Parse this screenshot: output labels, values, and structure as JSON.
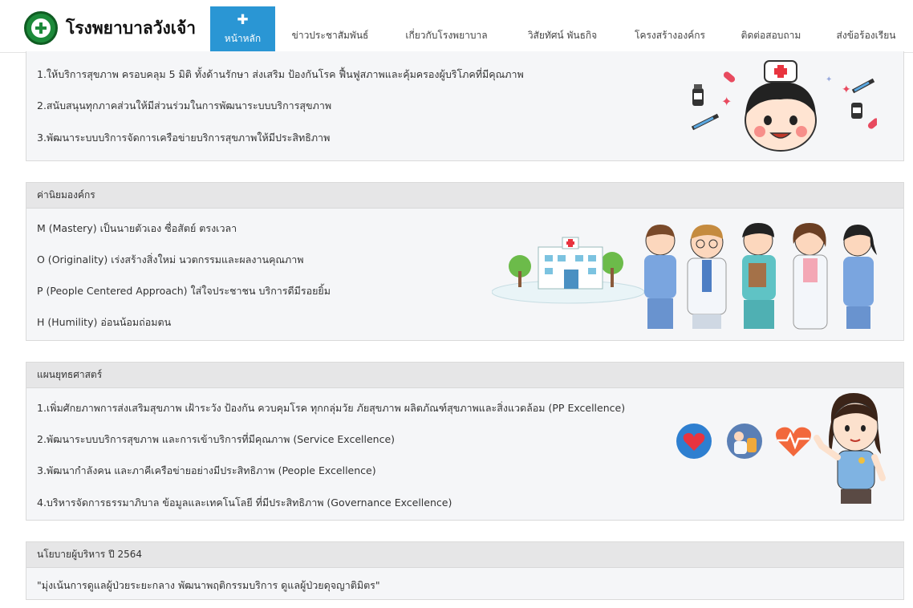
{
  "header": {
    "brand_name": "โรงพยาบาลวังเจ้า",
    "nav": {
      "home_label": "หน้าหลัก",
      "items": [
        "ข่าวประชาสัมพันธ์",
        "เกี่ยวกับโรงพยาบาล",
        "วิสัยทัศน์ พันธกิจ",
        "โครงสร้างองค์กร",
        "ติดต่อสอบถาม",
        "ส่งข้อร้องเรียน"
      ]
    }
  },
  "mission": {
    "lines": [
      "1.ให้บริการสุขภาพ ครอบคลุม 5 มิติ ทั้งด้านรักษา ส่งเสริม ป้องกันโรค ฟื้นฟูสภาพและคุ้มครองผู้บริโภคที่มีคุณภาพ",
      "2.สนับสนุนทุกภาคส่วนให้มีส่วนร่วมในการพัฒนาระบบบริการสุขภาพ",
      "3.พัฒนาระบบบริการจัดการเครือข่ายบริการสุขภาพให้มีประสิทธิภาพ"
    ]
  },
  "values": {
    "title": "ค่านิยมองค์กร",
    "lines": [
      "M (Mastery) เป็นนายตัวเอง ซื่อสัตย์ ตรงเวลา",
      "O (Originality) เร่งสร้างสิ่งใหม่ นวตกรรมและผลงานคุณภาพ",
      "P (People Centered Approach) ใส่ใจประชาชน บริการดีมีรอยยิ้ม",
      "H (Humility) อ่อนน้อมถ่อมตน"
    ]
  },
  "strategy": {
    "title": "แผนยุทธศาสตร์",
    "lines": [
      "1.เพิ่มศักยภาพการส่งเสริมสุขภาพ เฝ้าระวัง ป้องกัน ควบคุมโรค ทุกกลุ่มวัย ภัยสุขภาพ ผลิตภัณฑ์สุขภาพและสิ่งแวดล้อม (PP Excellence)",
      "2.พัฒนาระบบบริการสุขภาพ และการเข้าบริการที่มีคุณภาพ (Service Excellence)",
      "3.พัฒนากำลังคน และภาคีเครือข่ายอย่างมีประสิทธิภาพ (People Excellence)",
      "4.บริหารจัดการธรรมาภิบาล ข้อมูลและเทคโนโลยี ที่มีประสิทธิภาพ (Governance Excellence)"
    ]
  },
  "policy": {
    "title": "นโยบายผู้บริหาร ปี 2564",
    "text": "\"มุ่งเน้นการดูแลผู้ป่วยระยะกลาง พัฒนาพฤติกรรมบริการ ดูแลผู้ป่วยดุจญาติมิตร\""
  },
  "colors": {
    "nav_active": "#2a96d4",
    "panel_bg": "#f5f6f8",
    "panel_head_bg": "#e6e6e7"
  }
}
